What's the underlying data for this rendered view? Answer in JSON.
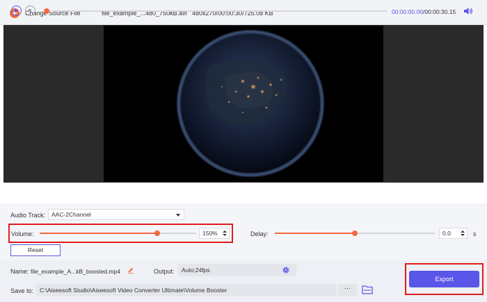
{
  "topbar": {
    "add_icon": "plus-icon",
    "change_source_label": "Change Source File",
    "file_name": "file_example_...480_750kB.avi",
    "file_info": "480x270/00:00:30/725.08 KB"
  },
  "player": {
    "current_time": "00:00:00.00",
    "separator": "/",
    "total_time": "00:00:30.15",
    "progress": 0.0
  },
  "audio": {
    "track_label": "Audio Track:",
    "track_value": "AAC-2Channel",
    "volume_label": "Volume:",
    "volume_value": "150%",
    "volume_level": 0.75,
    "delay_label": "Delay:",
    "delay_value": "0.0",
    "delay_unit": "s",
    "delay_level": 0.5,
    "reset_label": "Reset"
  },
  "export_panel": {
    "name_label": "Name:",
    "name_value": "file_example_A...kB_boosted.mp4",
    "output_label": "Output:",
    "output_value": "Auto;24fps",
    "save_to_label": "Save to:",
    "save_to_value": "C:\\Aiseesoft Studio\\Aiseesoft Video Converter Ultimate\\Volume Booster",
    "more_label": "···",
    "export_label": "Export"
  },
  "colors": {
    "accent": "#5a56e8",
    "slider": "#f26a3d",
    "highlight": "#e11b1b"
  }
}
